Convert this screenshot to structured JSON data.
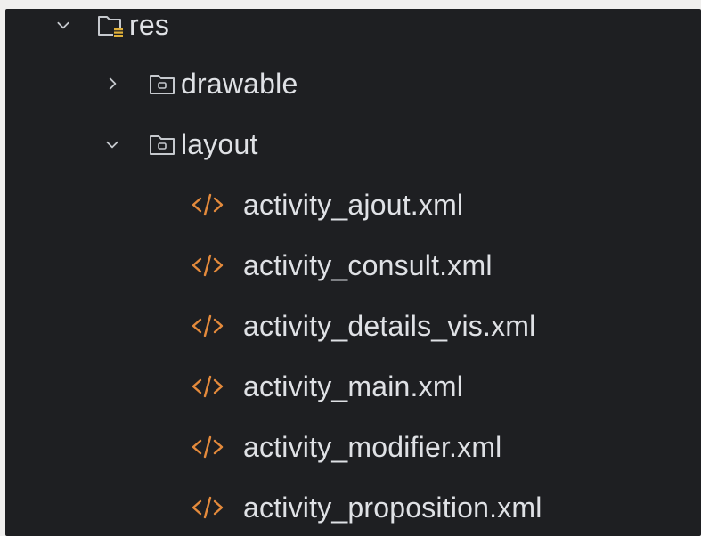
{
  "tree": {
    "res": {
      "label": "res",
      "expanded": true
    },
    "drawable": {
      "label": "drawable",
      "expanded": false
    },
    "layout": {
      "label": "layout",
      "expanded": true
    },
    "files": [
      {
        "label": "activity_ajout.xml"
      },
      {
        "label": "activity_consult.xml"
      },
      {
        "label": "activity_details_vis.xml"
      },
      {
        "label": "activity_main.xml"
      },
      {
        "label": "activity_modifier.xml"
      },
      {
        "label": "activity_proposition.xml"
      }
    ]
  },
  "colors": {
    "background": "#1e1f22",
    "text": "#dfe1e5",
    "xml_icon": "#e48a3c",
    "chevron": "#c6c9ce",
    "folder_outline": "#c6c9ce",
    "resource_badge": "#e0b13a"
  }
}
